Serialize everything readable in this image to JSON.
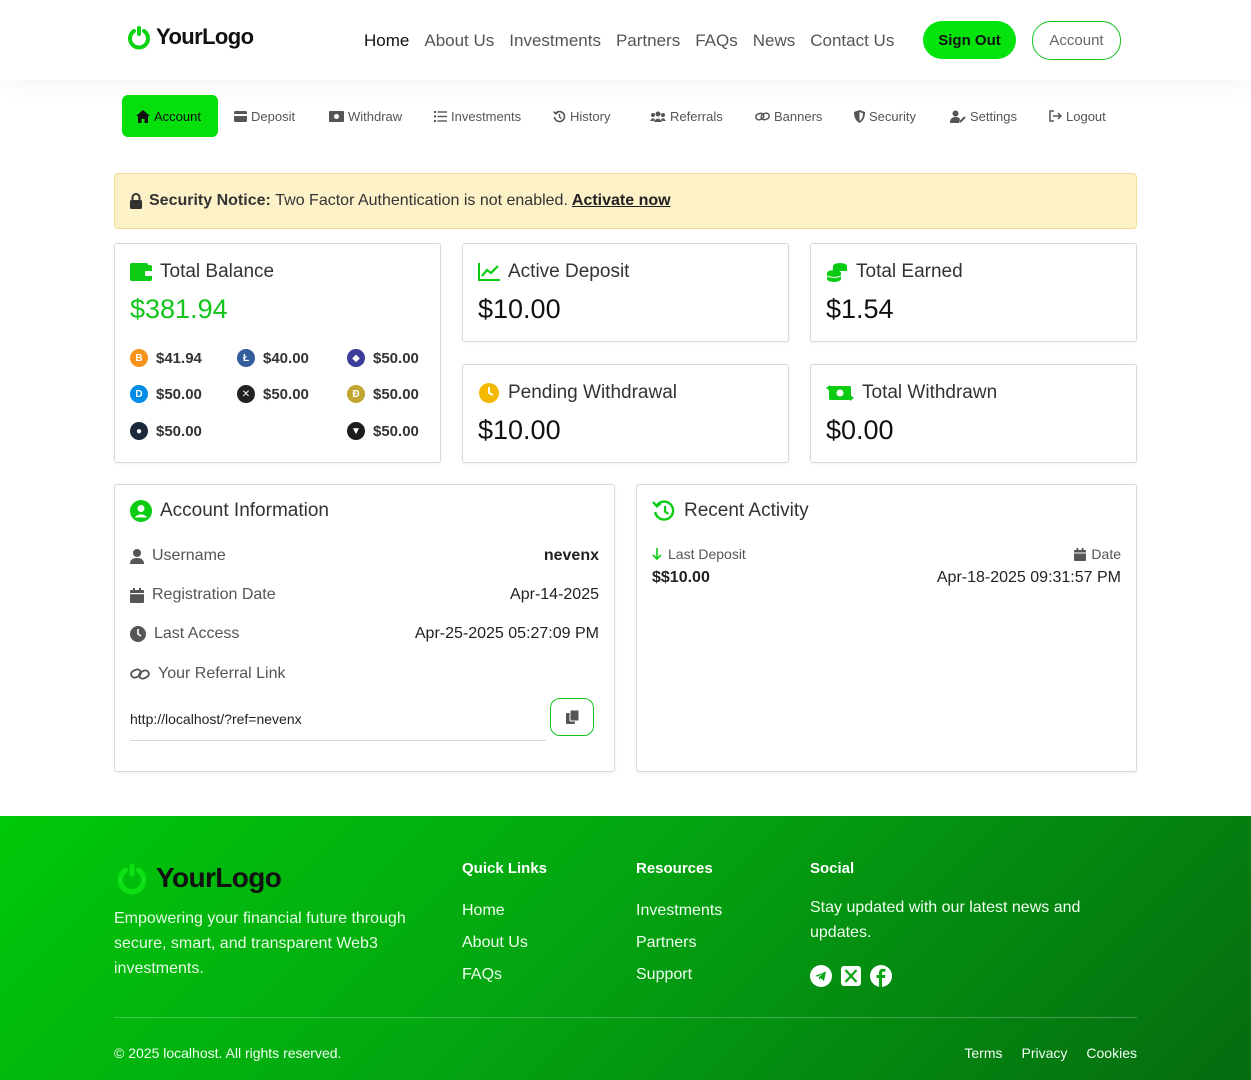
{
  "brand": {
    "logo_text": "YourLogo"
  },
  "nav": {
    "items": [
      "Home",
      "About Us",
      "Investments",
      "Partners",
      "FAQs",
      "News",
      "Contact Us"
    ],
    "signout": "Sign Out",
    "account": "Account"
  },
  "tabs": {
    "items": [
      "Account",
      "Deposit",
      "Withdraw",
      "Investments",
      "History",
      "Referrals",
      "Banners",
      "Security",
      "Settings",
      "Logout"
    ]
  },
  "notice": {
    "label": "Security Notice:",
    "text": "Two Factor Authentication is not enabled.",
    "link": "Activate now"
  },
  "balance": {
    "title": "Total Balance",
    "value": "$381.94",
    "coins": [
      {
        "icon": "bitcoin-icon",
        "value": "$41.94",
        "color": "#f7931a",
        "glyph": "B"
      },
      {
        "icon": "litecoin-icon",
        "value": "$40.00",
        "color": "#345d9d",
        "glyph": "Ł"
      },
      {
        "icon": "ethereum-icon",
        "value": "$50.00",
        "color": "#3c3c9a",
        "glyph": "◆"
      },
      {
        "icon": "dash-icon",
        "value": "$50.00",
        "color": "#008ce7",
        "glyph": "D"
      },
      {
        "icon": "xrp-icon",
        "value": "$50.00",
        "color": "#222",
        "glyph": "✕"
      },
      {
        "icon": "dogecoin-icon",
        "value": "$50.00",
        "color": "#c2a633",
        "glyph": "Ð"
      },
      {
        "icon": "coin-dark-icon",
        "value": "$50.00",
        "color": "#1b2a3a",
        "glyph": "●"
      },
      {
        "icon": "tron-icon",
        "value": "$50.00",
        "color": "#1c1c1c",
        "glyph": "▼"
      }
    ]
  },
  "stats": [
    {
      "title": "Active Deposit",
      "value": "$10.00"
    },
    {
      "title": "Total Earned",
      "value": "$1.54"
    },
    {
      "title": "Pending Withdrawal",
      "value": "$10.00"
    },
    {
      "title": "Total Withdrawn",
      "value": "$0.00"
    }
  ],
  "account_info": {
    "title": "Account Information",
    "username_label": "Username",
    "username": "nevenx",
    "reg_label": "Registration Date",
    "reg": "Apr-14-2025",
    "access_label": "Last Access",
    "access": "Apr-25-2025 05:27:09 PM",
    "ref_label": "Your Referral Link",
    "ref_link": "http://localhost/?ref=nevenx"
  },
  "activity": {
    "title": "Recent Activity",
    "last_label": "Last Deposit",
    "date_label": "Date",
    "amount": "$$10.00",
    "date": "Apr-18-2025 09:31:57 PM"
  },
  "footer": {
    "logo_text": "YourLogo",
    "desc": "Empowering your financial future through secure, smart, and transparent Web3 investments.",
    "quick_title": "Quick Links",
    "quick": [
      "Home",
      "About Us",
      "FAQs"
    ],
    "res_title": "Resources",
    "res": [
      "Investments",
      "Partners",
      "Support"
    ],
    "social_title": "Social",
    "social_text": "Stay updated with our latest news and updates.",
    "copyright": "© 2025 localhost. All rights reserved.",
    "legal": [
      "Terms",
      "Privacy",
      "Cookies"
    ]
  },
  "colors": {
    "accent": "#05e30d",
    "accent_dark": "#17c11f",
    "notice_bg": "#fdf1c8"
  }
}
